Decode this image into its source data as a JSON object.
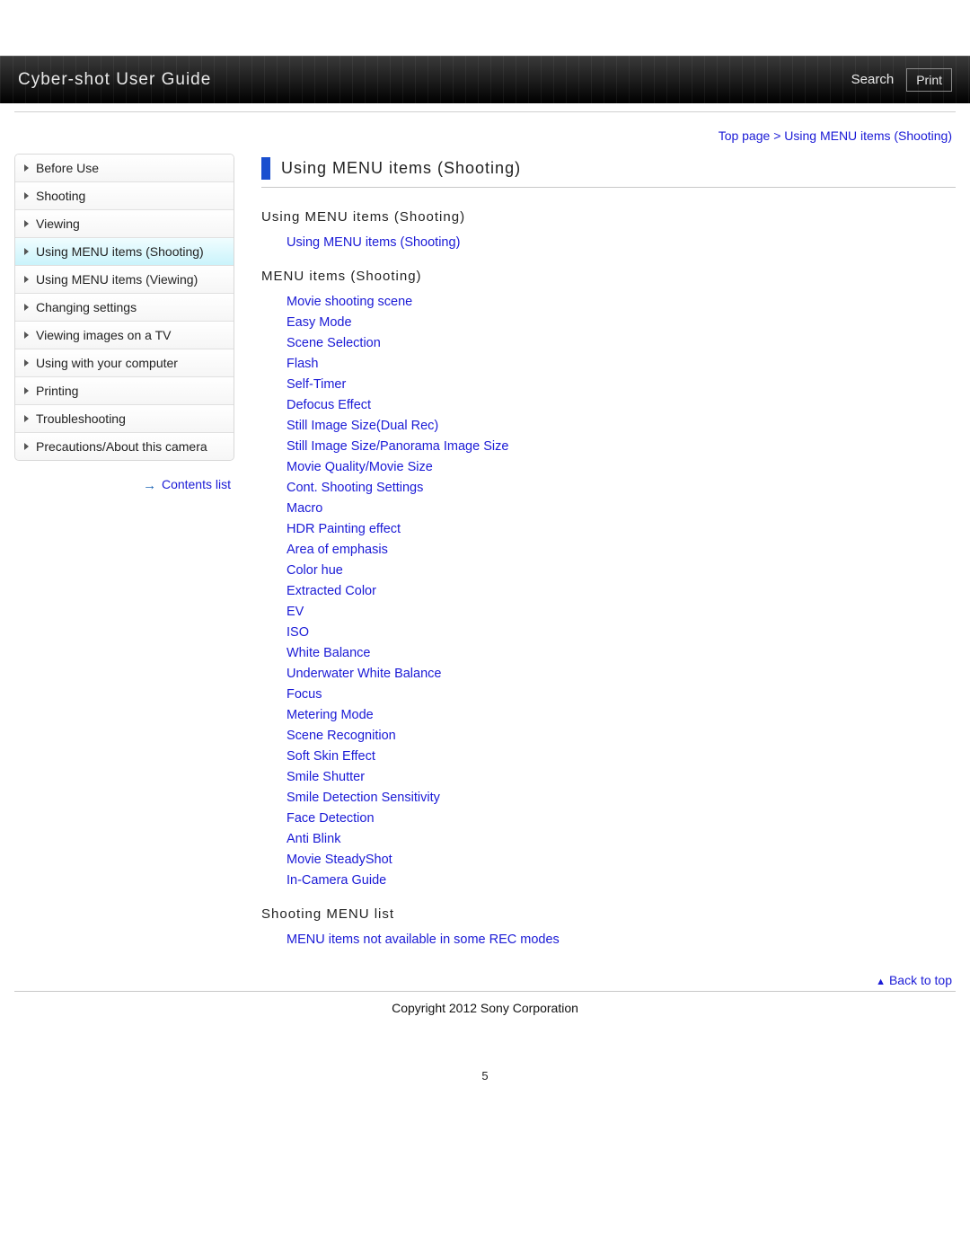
{
  "header": {
    "title": "Cyber-shot User Guide",
    "search": "Search",
    "print": "Print"
  },
  "breadcrumb": {
    "top": "Top page",
    "current": "Using MENU items (Shooting)"
  },
  "sidebar": {
    "items": [
      {
        "label": "Before Use"
      },
      {
        "label": "Shooting"
      },
      {
        "label": "Viewing"
      },
      {
        "label": "Using MENU items (Shooting)",
        "selected": true
      },
      {
        "label": "Using MENU items (Viewing)"
      },
      {
        "label": "Changing settings"
      },
      {
        "label": "Viewing images on a TV"
      },
      {
        "label": "Using with your computer"
      },
      {
        "label": "Printing"
      },
      {
        "label": "Troubleshooting"
      },
      {
        "label": "Precautions/About this camera"
      }
    ],
    "contents_list": "Contents list"
  },
  "main": {
    "title": "Using MENU items (Shooting)",
    "sections": [
      {
        "heading": "Using MENU items (Shooting)",
        "links": [
          "Using MENU items (Shooting)"
        ]
      },
      {
        "heading": "MENU items (Shooting)",
        "links": [
          "Movie shooting scene",
          "Easy Mode",
          "Scene Selection",
          "Flash",
          "Self-Timer",
          "Defocus Effect",
          "Still Image Size(Dual Rec)",
          "Still Image Size/Panorama Image Size",
          "Movie Quality/Movie Size",
          "Cont. Shooting Settings",
          "Macro",
          "HDR Painting effect",
          "Area of emphasis",
          "Color hue",
          "Extracted Color",
          "EV",
          "ISO",
          "White Balance",
          "Underwater White Balance",
          "Focus",
          "Metering Mode",
          "Scene Recognition",
          "Soft Skin Effect",
          "Smile Shutter",
          "Smile Detection Sensitivity",
          "Face Detection",
          "Anti Blink",
          "Movie SteadyShot",
          "In-Camera Guide"
        ]
      },
      {
        "heading": "Shooting MENU list",
        "links": [
          "MENU items not available in some REC modes"
        ]
      }
    ]
  },
  "footer": {
    "back_to_top": "Back to top",
    "copyright": "Copyright 2012 Sony Corporation",
    "page_number": "5"
  }
}
